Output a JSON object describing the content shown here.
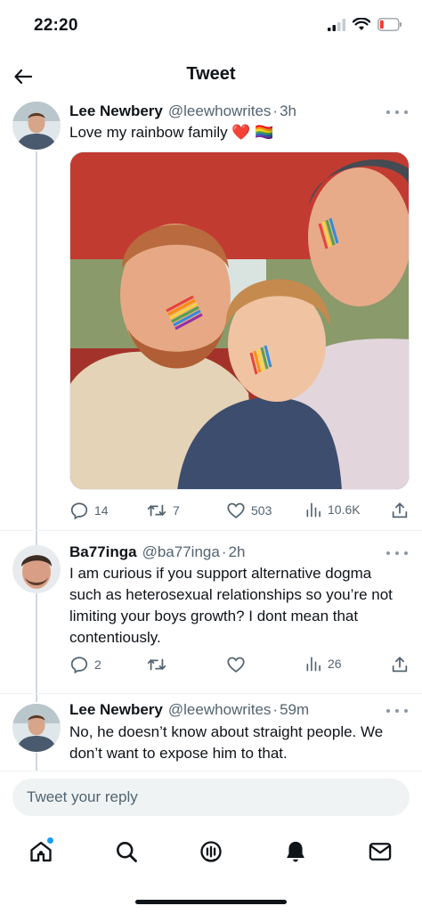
{
  "status_bar": {
    "time": "22:20"
  },
  "nav": {
    "title": "Tweet"
  },
  "tweets": [
    {
      "name": "Lee Newbery",
      "handle": "@leewhowrites",
      "time": "3h",
      "text": "Love my rainbow family ❤️ 🏳️‍🌈",
      "replies": "14",
      "retweets": "7",
      "likes": "503",
      "views": "10.6K"
    },
    {
      "name": "Ba77inga",
      "handle": "@ba77inga",
      "time": "2h",
      "text": "I am curious if you support alternative dogma such as heterosexual relationships so you’re not limiting your boys growth? I dont mean that contentiously.",
      "replies": "2",
      "views": "26"
    },
    {
      "name": "Lee Newbery",
      "handle": "@leewhowrites",
      "time": "59m",
      "text": "No, he doesn’t know about straight people. We don’t want to expose him to that."
    }
  ],
  "reply_box": {
    "placeholder": "Tweet your reply"
  },
  "colors": {
    "accent": "#1d9bf0",
    "text": "#0f1419",
    "secondary": "#536471",
    "divider": "#eff3f4"
  }
}
